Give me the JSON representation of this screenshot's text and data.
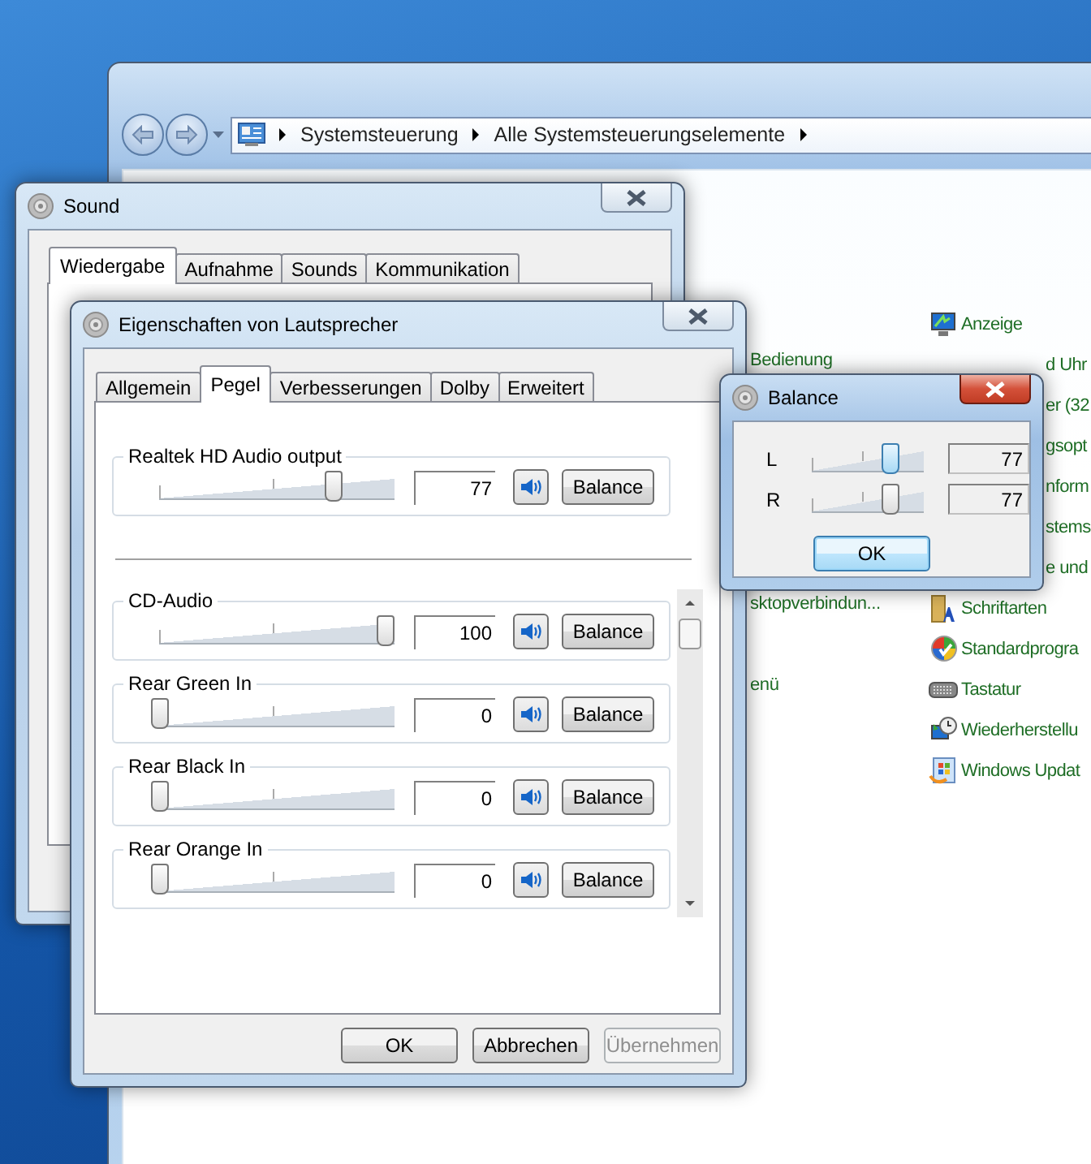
{
  "control_panel": {
    "breadcrumb": [
      {
        "label": "Systemsteuerung"
      },
      {
        "label": "Alle Systemsteuerungselemente"
      }
    ],
    "rows": [
      {
        "right": {
          "kind": "display",
          "label": "Anzeige"
        }
      },
      {
        "left": {
          "label": "Bedienung"
        },
        "right": {
          "kind": "partial",
          "label": "d Uhr"
        }
      },
      {
        "right": {
          "kind": "partial",
          "label": "er (32"
        }
      },
      {
        "right": {
          "kind": "partial",
          "label": "gsopt"
        }
      },
      {
        "right": {
          "kind": "partial",
          "label": "nform"
        }
      },
      {
        "right": {
          "kind": "partial",
          "label": "stems"
        }
      },
      {
        "right": {
          "kind": "partial",
          "label": "e und"
        }
      },
      {
        "left": {
          "label": "sktopverbindun..."
        },
        "right": {
          "kind": "fonts",
          "label": "Schriftarten"
        }
      },
      {
        "right": {
          "kind": "defaults",
          "label": "Standardprogra"
        }
      },
      {
        "left": {
          "label": "enü"
        },
        "right": {
          "kind": "keyboard",
          "label": "Tastatur"
        }
      },
      {
        "right": {
          "kind": "restore",
          "label": "Wiederherstellu"
        }
      },
      {
        "right": {
          "kind": "update",
          "label": "Windows Updat"
        }
      }
    ]
  },
  "sound_window": {
    "title": "Sound",
    "active": false,
    "tabs": [
      {
        "label": "Wiedergabe",
        "selected": true
      },
      {
        "label": "Aufnahme",
        "selected": false
      },
      {
        "label": "Sounds",
        "selected": false
      },
      {
        "label": "Kommunikation",
        "selected": false
      }
    ]
  },
  "properties_window": {
    "title": "Eigenschaften von Lautsprecher",
    "active": false,
    "tabs": [
      {
        "label": "Allgemein",
        "selected": false
      },
      {
        "label": "Pegel",
        "selected": true
      },
      {
        "label": "Verbesserungen",
        "selected": false
      },
      {
        "label": "Dolby",
        "selected": false
      },
      {
        "label": "Erweitert",
        "selected": false
      }
    ],
    "master": {
      "name": "Realtek HD Audio output",
      "level": 0.77,
      "value": "77",
      "balance": "Balance"
    },
    "channels": [
      {
        "name": "CD-Audio",
        "level": 1,
        "value": "100",
        "balance": "Balance"
      },
      {
        "name": "Rear Green In",
        "level": 0,
        "value": "0",
        "balance": "Balance"
      },
      {
        "name": "Rear Black In",
        "level": 0,
        "value": "0",
        "balance": "Balance"
      },
      {
        "name": "Rear Orange In",
        "level": 0,
        "value": "0",
        "balance": "Balance"
      }
    ],
    "buttons": [
      {
        "label": "OK",
        "disabled": false
      },
      {
        "label": "Abbrechen",
        "disabled": false
      },
      {
        "label": "Übernehmen",
        "disabled": true
      }
    ]
  },
  "balance_window": {
    "title": "Balance",
    "active": true,
    "channels": [
      {
        "label": "L",
        "level": 0.77,
        "value": "77",
        "focused": true
      },
      {
        "label": "R",
        "level": 0.77,
        "value": "77",
        "focused": false
      }
    ],
    "ok": {
      "label": "OK",
      "focused": true
    }
  }
}
